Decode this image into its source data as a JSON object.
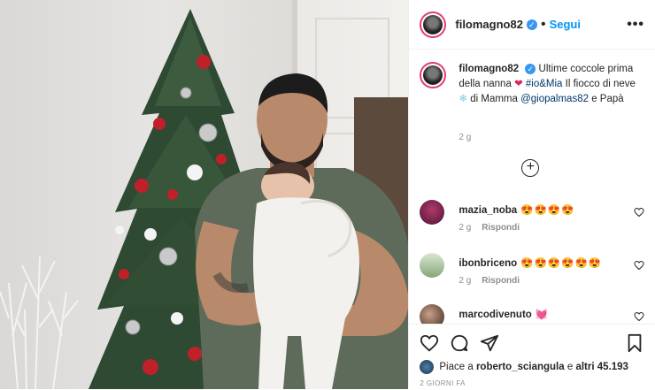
{
  "header": {
    "username": "filomagno82",
    "verified_mark": "✓",
    "separator": "•",
    "follow_label": "Segui",
    "more_label": "•••"
  },
  "caption": {
    "username": "filomagno82",
    "text_part1": "Ultime coccole prima della nanna",
    "heart": "❤",
    "hashtag": "#io&Mia",
    "text_part2": "Il fiocco di neve",
    "snowflake": "❄",
    "text_part3": "di Mamma",
    "mention": "@giopalmas82",
    "text_part4": "e Papà",
    "time": "2 g"
  },
  "load_more_label": "+",
  "comments": [
    {
      "username": "mazia_noba",
      "emoji": "😍😍😍😍",
      "time": "2 g",
      "reply": "Rispondi"
    },
    {
      "username": "ibonbriceno",
      "emoji": "😍😍😍😍😍😍",
      "time": "2 g",
      "reply": "Rispondi"
    },
    {
      "username": "marcodivenuto",
      "emoji": "💓",
      "time": "",
      "reply": ""
    }
  ],
  "actions": {
    "icons": [
      "heart-icon",
      "comment-icon",
      "share-icon",
      "bookmark-icon"
    ]
  },
  "likes": {
    "prefix": "Piace a",
    "user": "roberto_sciangula",
    "middle": "e",
    "others": "altri 45.193"
  },
  "date": "2 GIORNI FA",
  "colors": {
    "follow": "#0095f6",
    "verified": "#3897f0",
    "mention": "#00376b",
    "heart": "#e0245e"
  }
}
